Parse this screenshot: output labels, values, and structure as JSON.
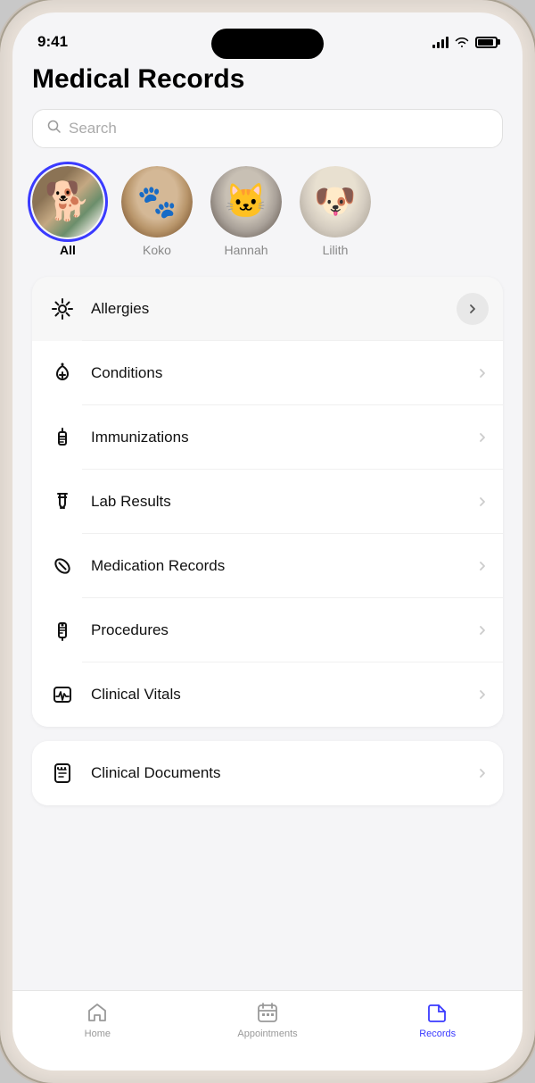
{
  "status": {
    "time": "9:41"
  },
  "header": {
    "title": "Medical Records"
  },
  "search": {
    "placeholder": "Search"
  },
  "pets": [
    {
      "id": "all",
      "name": "All",
      "selected": true
    },
    {
      "id": "koko",
      "name": "Koko",
      "selected": false
    },
    {
      "id": "hannah",
      "name": "Hannah",
      "selected": false
    },
    {
      "id": "lilith",
      "name": "Lilith",
      "selected": false
    }
  ],
  "menu_items": [
    {
      "label": "Allergies",
      "icon": "allergies-icon",
      "active": true
    },
    {
      "label": "Conditions",
      "icon": "conditions-icon",
      "active": false
    },
    {
      "label": "Immunizations",
      "icon": "immunizations-icon",
      "active": false
    },
    {
      "label": "Lab Results",
      "icon": "lab-results-icon",
      "active": false
    },
    {
      "label": "Medication Records",
      "icon": "medication-icon",
      "active": false
    },
    {
      "label": "Procedures",
      "icon": "procedures-icon",
      "active": false
    },
    {
      "label": "Clinical Vitals",
      "icon": "vitals-icon",
      "active": false
    }
  ],
  "documents": {
    "label": "Clinical Documents",
    "icon": "documents-icon"
  },
  "tabs": [
    {
      "id": "home",
      "label": "Home",
      "active": false
    },
    {
      "id": "appointments",
      "label": "Appointments",
      "active": false
    },
    {
      "id": "records",
      "label": "Records",
      "active": true
    }
  ]
}
